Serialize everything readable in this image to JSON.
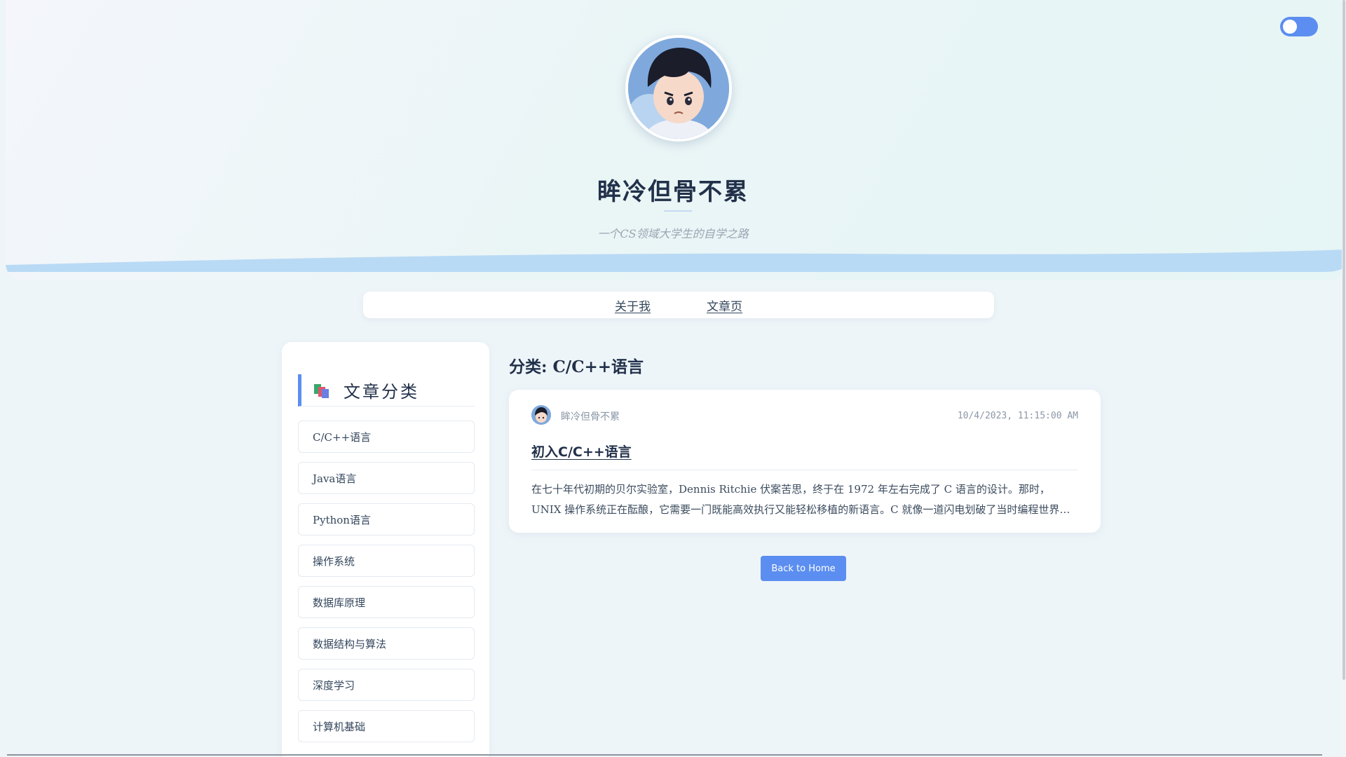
{
  "header": {
    "site_title": "眸冷但骨不累",
    "subtitle": "一个CS领域大学生的自学之路",
    "avatar_icon": "avatar-image",
    "theme_toggle_icon": "toggle-switch-icon"
  },
  "nav": {
    "about": "关于我",
    "articles": "文章页"
  },
  "sidebar": {
    "title": "文章分类",
    "icon": "books-icon",
    "categories": [
      "C/C++语言",
      "Java语言",
      "Python语言",
      "操作系统",
      "数据库原理",
      "数据结构与算法",
      "深度学习",
      "计算机基础"
    ]
  },
  "main": {
    "category_heading": "分类: C/C++语言",
    "post": {
      "author": "眸冷但骨不累",
      "date": "10/4/2023, 11:15:00 AM",
      "title": "初入C/C++语言",
      "excerpt": "在七十年代初期的贝尔实验室，Dennis Ritchie 伏案苦思，终于在 1972 年左右完成了 C 语言的设计。那时，UNIX 操作系统正在酝酿，它需要一门既能高效执行又能轻松移植的新语言。C 就像一道闪电划破了当时编程世界的夜空。"
    },
    "back_button": "Back to Home"
  },
  "colors": {
    "accent": "#5b8ef0",
    "wave": "#b9daf5",
    "title": "#22314a",
    "background": "#eef5f9"
  }
}
